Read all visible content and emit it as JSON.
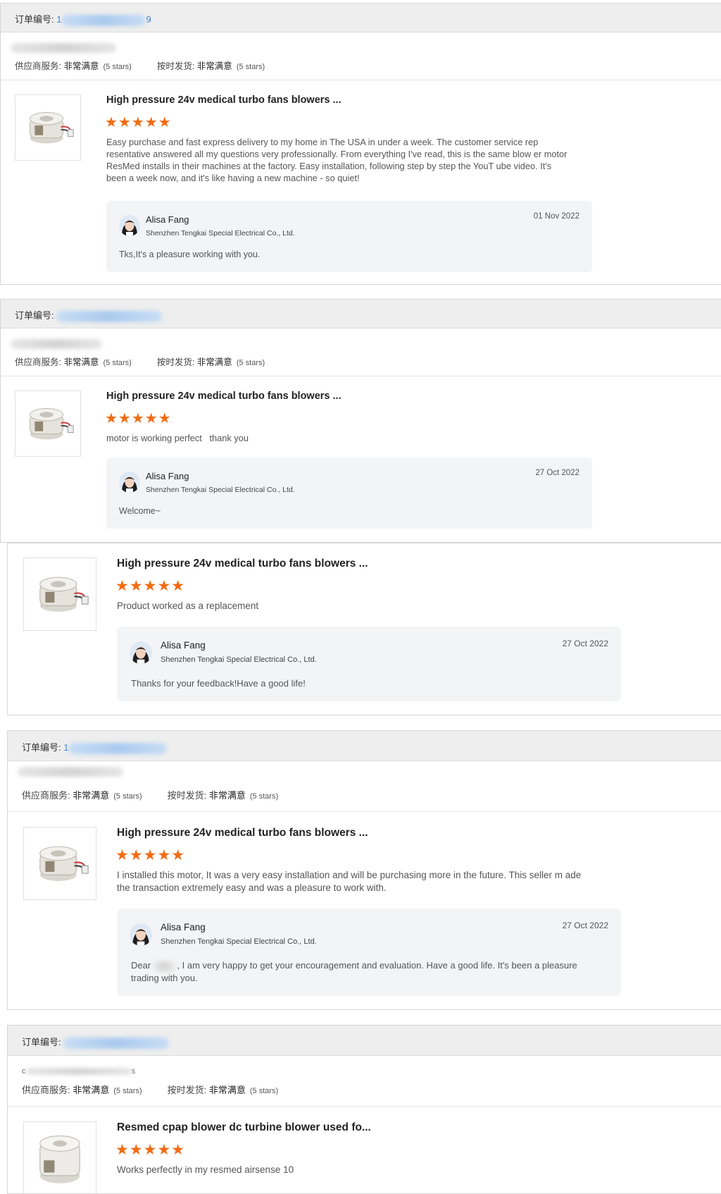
{
  "order_label": "订单编号:",
  "ratings": {
    "supplier_label": "供应商服务:",
    "supplier_value": "非常满意",
    "supplier_stars": "(5 stars)",
    "shipping_label": "按时发货:",
    "shipping_value": "非常满意",
    "shipping_stars": "(5 stars)"
  },
  "stars_glyph": "★★★★★",
  "reviews": [
    {
      "order_prefix": "1",
      "order_suffix": "9",
      "product_title": "High pressure 24v medical turbo fans blowers ...",
      "text": "Easy purchase and fast express delivery to my home in The USA in under a week. The customer service rep resentative answered all my questions very professionally. From everything I've read, this is the same blow er motor ResMed installs in their machines at the factory. Easy installation, following step by step the YouT ube video. It's been a week now, and it's like having a new machine - so quiet!",
      "reply": {
        "name": "Alisa Fang",
        "company": "Shenzhen Tengkai Special Electrical Co., Ltd.",
        "date": "01 Nov 2022",
        "message": "Tks,It's a pleasure working with you."
      }
    },
    {
      "order_prefix": "",
      "product_title": "High pressure 24v medical turbo fans blowers ...",
      "text": "motor is working perfect   thank you",
      "reply": {
        "name": "Alisa Fang",
        "company": "Shenzhen Tengkai Special Electrical Co., Ltd.",
        "date": "27 Oct 2022",
        "message": "Welcome~"
      }
    },
    {
      "product_title": "High pressure 24v medical turbo fans blowers ...",
      "text": "Product worked as a replacement",
      "reply": {
        "name": "Alisa Fang",
        "company": "Shenzhen Tengkai Special Electrical Co., Ltd.",
        "date": "27 Oct 2022",
        "message": "Thanks for your feedback!Have a good life!"
      }
    },
    {
      "order_prefix": "1",
      "product_title": "High pressure 24v medical turbo fans blowers ...",
      "text": "I installed this motor, It was a very easy installation and will be purchasing more in the future. This seller m ade the transaction extremely easy and was a pleasure to work with.",
      "reply": {
        "name": "Alisa Fang",
        "company": "Shenzhen Tengkai Special Electrical Co., Ltd.",
        "date": "27 Oct 2022",
        "message_before": "Dear",
        "message_after": ", I am very happy to get your encouragement and evaluation. Have a good life. It's been a pleasure trading with you."
      }
    },
    {
      "order_prefix": "",
      "buyer_first": "c",
      "buyer_last": "s",
      "product_title": "Resmed cpap blower dc turbine blower used fo...",
      "text": "Works perfectly in my resmed airsense 10"
    }
  ]
}
